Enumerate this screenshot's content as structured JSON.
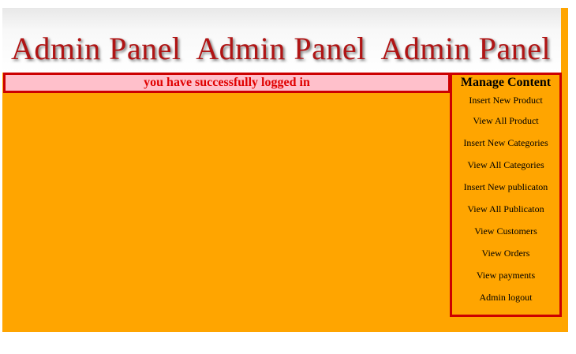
{
  "header": {
    "title": "Admin Panel  Admin Panel  Admin Panel"
  },
  "notice": {
    "text": "you have successfully logged in"
  },
  "sidebar": {
    "heading": "Manage Content",
    "items": [
      {
        "label": "Insert New Product"
      },
      {
        "label": "View All Product"
      },
      {
        "label": "Insert New Categories"
      },
      {
        "label": "View All Categories"
      },
      {
        "label": "Insert New publicaton"
      },
      {
        "label": "View All Publicaton"
      },
      {
        "label": "View Customers"
      },
      {
        "label": "View Orders"
      },
      {
        "label": "View payments"
      },
      {
        "label": "Admin logout"
      }
    ]
  },
  "colors": {
    "background": "#ffa500",
    "title": "#b01515",
    "notice_bg": "#ffc0cb",
    "notice_text": "#e00000",
    "border": "#cc0000"
  }
}
